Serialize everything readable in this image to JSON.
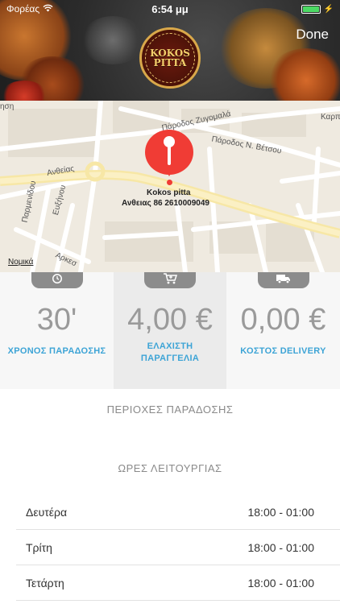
{
  "status_bar": {
    "carrier": "Φορέας",
    "time": "6:54 μμ"
  },
  "header": {
    "done_label": "Done",
    "logo_text_line1": "KOKOS",
    "logo_text_line2": "PITTA"
  },
  "map": {
    "place_name": "Kokos pitta",
    "place_address": "Ανθειας 86 2610009049",
    "legal_label": "Νομικά",
    "streets": [
      "Πάροδος Ζυγομαλά",
      "Πάροδος Ν. Βέτσου",
      "Ανθείας",
      "Καρπ",
      "Παρμενίδου",
      "Ευξήνου",
      "Αρκεσ",
      "ηση"
    ]
  },
  "stats": [
    {
      "icon": "clock-icon",
      "value": "30'",
      "label_line1": "ΧΡΟΝΟΣ ΠΑΡΑΔΟΣΗΣ",
      "label_line2": ""
    },
    {
      "icon": "cart-icon",
      "value": "4,00 €",
      "label_line1": "ΕΛΑΧΙΣΤΗ",
      "label_line2": "ΠΑΡΑΓΓΕΛΙΑ"
    },
    {
      "icon": "truck-icon",
      "value": "0,00 €",
      "label_line1": "ΚΟΣΤΟΣ DELIVERY",
      "label_line2": ""
    }
  ],
  "sections": {
    "delivery_areas_title": "ΠΕΡΙΟΧΕΣ ΠΑΡΑΔΟΣΗΣ",
    "hours_title": "ΩΡΕΣ ΛΕΙΤΟΥΡΓΙΑΣ"
  },
  "hours": [
    {
      "day": "Δευτέρα",
      "time": "18:00 - 01:00"
    },
    {
      "day": "Τρίτη",
      "time": "18:00 - 01:00"
    },
    {
      "day": "Τετάρτη",
      "time": "18:00 - 01:00"
    }
  ],
  "colors": {
    "accent": "#3da4d6",
    "pin": "#f03c35",
    "tab": "#8c8c8c"
  }
}
